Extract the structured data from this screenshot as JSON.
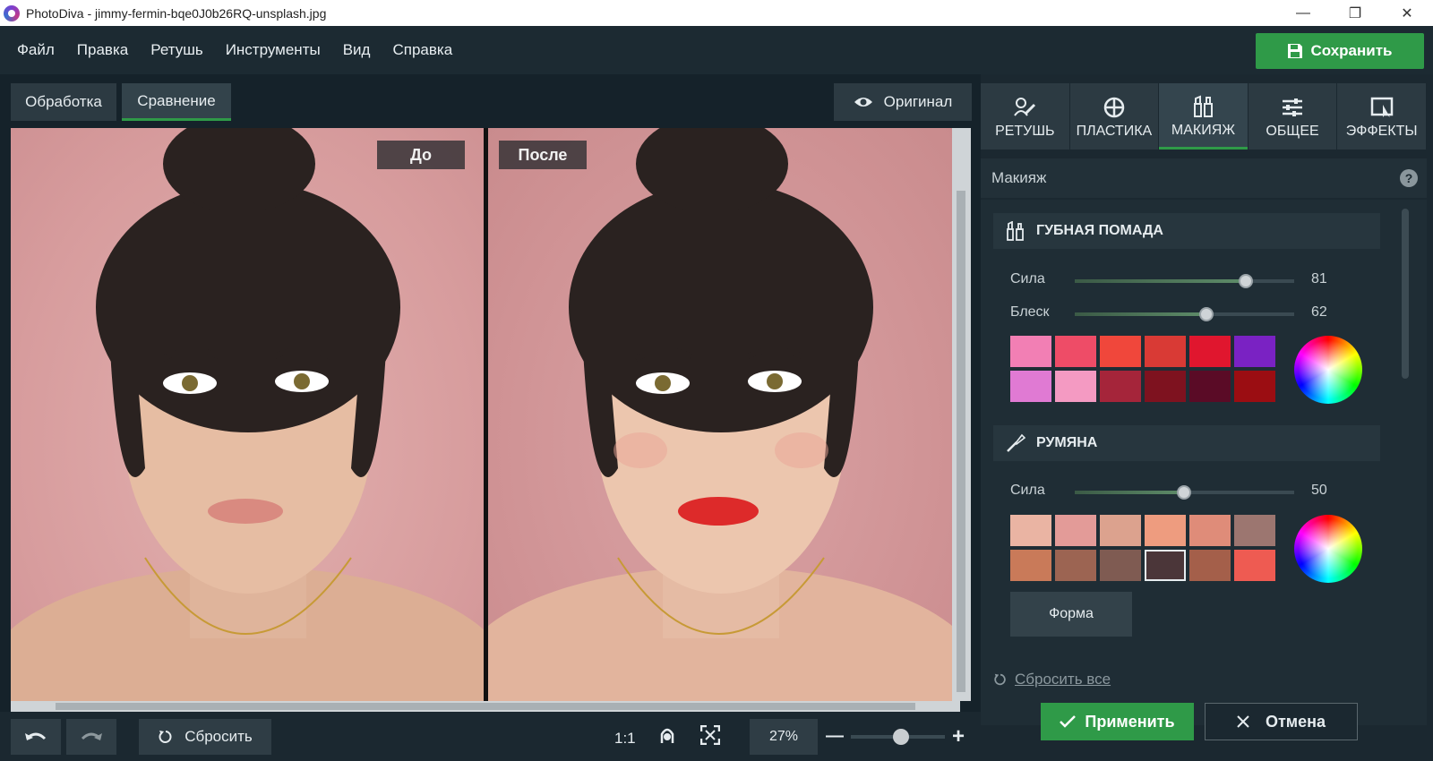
{
  "window": {
    "title": "PhotoDiva - jimmy-fermin-bqe0J0b26RQ-unsplash.jpg",
    "minimize": "—",
    "maximize": "❐",
    "close": "✕"
  },
  "menu": {
    "items": [
      "Файл",
      "Правка",
      "Ретушь",
      "Инструменты",
      "Вид",
      "Справка"
    ],
    "save_label": "Сохранить"
  },
  "workspace": {
    "tabs": [
      {
        "label": "Обработка",
        "active": false
      },
      {
        "label": "Сравнение",
        "active": true
      }
    ],
    "original_label": "Оригинал",
    "before_label": "До",
    "after_label": "После"
  },
  "bottombar": {
    "reset_label": "Сбросить",
    "ratio_label": "1:1",
    "zoom_value": "27%",
    "zoom_minus": "—",
    "zoom_plus": "+"
  },
  "panel": {
    "tabs": [
      {
        "label": "РЕТУШЬ",
        "icon": "retouch-icon",
        "active": false
      },
      {
        "label": "ПЛАСТИКА",
        "icon": "plastic-icon",
        "active": false
      },
      {
        "label": "МАКИЯЖ",
        "icon": "makeup-icon",
        "active": true
      },
      {
        "label": "ОБЩЕЕ",
        "icon": "sliders-icon",
        "active": false
      },
      {
        "label": "ЭФФЕКТЫ",
        "icon": "effects-icon",
        "active": false
      }
    ],
    "section_title": "Макияж",
    "help": "?",
    "lipstick": {
      "title": "ГУБНАЯ ПОМАДА",
      "strength_label": "Сила",
      "strength_value": "81",
      "gloss_label": "Блеск",
      "gloss_value": "62",
      "colors": [
        "#f27fb4",
        "#ee4c67",
        "#f0473b",
        "#d93a35",
        "#e0162e",
        "#7a22c3",
        "#e07ad3",
        "#f49ac2",
        "#a5253a",
        "#7e121f",
        "#5a0b26",
        "#9b0d12"
      ]
    },
    "blush": {
      "title": "РУМЯНА",
      "strength_label": "Сила",
      "strength_value": "50",
      "colors": [
        "#eab4a3",
        "#e39b98",
        "#dca28e",
        "#ee9c7f",
        "#df8c79",
        "#9c7670",
        "#c97a59",
        "#9c6452",
        "#7f5b52",
        "#4b3639",
        "#a45f4a",
        "#ee5b52"
      ],
      "selected_index": 9,
      "shape_label": "Форма"
    },
    "reset_all_label": "Сбросить все",
    "apply_label": "Применить",
    "cancel_label": "Отмена"
  },
  "colors": {
    "accent": "#2f9a48",
    "background": "#1b2830",
    "photo_background": "#d9a3a4"
  }
}
